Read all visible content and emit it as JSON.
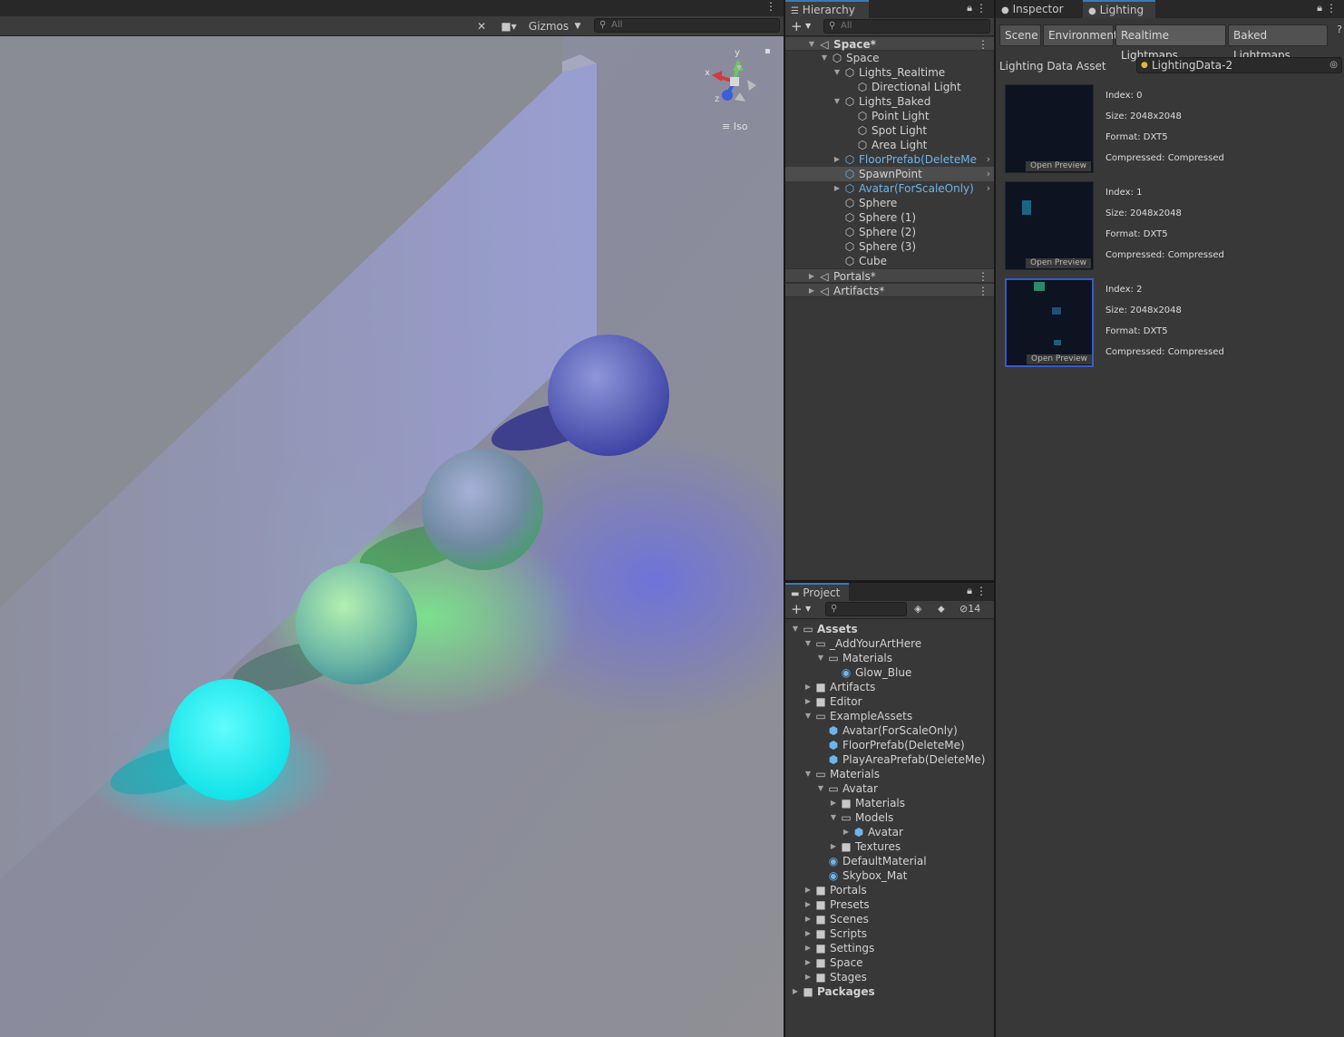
{
  "scene": {
    "toolbar": {
      "tools_icon": "crossed-tools-icon",
      "camera_icon": "camera-icon",
      "gizmos_label": "Gizmos",
      "search_placeholder": "All"
    },
    "gizmo": {
      "x_label": "x",
      "y_label": "y",
      "z_label": "z",
      "projection_label": "Iso"
    }
  },
  "hierarchy": {
    "tab_label": "Hierarchy",
    "search_placeholder": "All",
    "items": [
      {
        "label": "Space*",
        "kind": "scene",
        "depth": 0,
        "expanded": true
      },
      {
        "label": "Space",
        "kind": "object",
        "depth": 1,
        "expanded": true
      },
      {
        "label": "Lights_Realtime",
        "kind": "object",
        "depth": 2,
        "expanded": true
      },
      {
        "label": "Directional Light",
        "kind": "object",
        "depth": 3
      },
      {
        "label": "Lights_Baked",
        "kind": "object",
        "depth": 2,
        "expanded": true
      },
      {
        "label": "Point Light",
        "kind": "object",
        "depth": 3
      },
      {
        "label": "Spot Light",
        "kind": "object",
        "depth": 3
      },
      {
        "label": "Area Light",
        "kind": "object",
        "depth": 3
      },
      {
        "label": "FloorPrefab(DeleteMe",
        "kind": "prefab",
        "depth": 2,
        "expanded": false
      },
      {
        "label": "SpawnPoint",
        "kind": "prefab-plain",
        "depth": 2
      },
      {
        "label": "Avatar(ForScaleOnly)",
        "kind": "prefab",
        "depth": 2,
        "expanded": false
      },
      {
        "label": "Sphere",
        "kind": "object",
        "depth": 2
      },
      {
        "label": "Sphere (1)",
        "kind": "object",
        "depth": 2
      },
      {
        "label": "Sphere (2)",
        "kind": "object",
        "depth": 2
      },
      {
        "label": "Sphere (3)",
        "kind": "object",
        "depth": 2
      },
      {
        "label": "Cube",
        "kind": "object",
        "depth": 2
      },
      {
        "label": "Portals*",
        "kind": "scene",
        "depth": 0,
        "expanded": false
      },
      {
        "label": "Artifacts*",
        "kind": "scene",
        "depth": 0,
        "expanded": false
      }
    ]
  },
  "project": {
    "tab_label": "Project",
    "hidden_count": "14",
    "items": [
      {
        "label": "Assets",
        "kind": "folder",
        "depth": 0,
        "expanded": true,
        "bold": true
      },
      {
        "label": "_AddYourArtHere",
        "kind": "folder",
        "depth": 1,
        "expanded": true
      },
      {
        "label": "Materials",
        "kind": "folder",
        "depth": 2,
        "expanded": true
      },
      {
        "label": "Glow_Blue",
        "kind": "material",
        "depth": 3
      },
      {
        "label": "Artifacts",
        "kind": "folder",
        "depth": 1,
        "expanded": false
      },
      {
        "label": "Editor",
        "kind": "folder",
        "depth": 1,
        "expanded": false
      },
      {
        "label": "ExampleAssets",
        "kind": "folder",
        "depth": 1,
        "expanded": true
      },
      {
        "label": "Avatar(ForScaleOnly)",
        "kind": "prefab",
        "depth": 2
      },
      {
        "label": "FloorPrefab(DeleteMe)",
        "kind": "prefab",
        "depth": 2
      },
      {
        "label": "PlayAreaPrefab(DeleteMe)",
        "kind": "prefab",
        "depth": 2
      },
      {
        "label": "Materials",
        "kind": "folder",
        "depth": 1,
        "expanded": true
      },
      {
        "label": "Avatar",
        "kind": "folder",
        "depth": 2,
        "expanded": true
      },
      {
        "label": "Materials",
        "kind": "folder",
        "depth": 3,
        "expanded": false
      },
      {
        "label": "Models",
        "kind": "folder",
        "depth": 3,
        "expanded": true
      },
      {
        "label": "Avatar",
        "kind": "prefab",
        "depth": 4,
        "expanded": false
      },
      {
        "label": "Textures",
        "kind": "folder",
        "depth": 3,
        "expanded": false
      },
      {
        "label": "DefaultMaterial",
        "kind": "material",
        "depth": 2
      },
      {
        "label": "Skybox_Mat",
        "kind": "material",
        "depth": 2
      },
      {
        "label": "Portals",
        "kind": "folder",
        "depth": 1,
        "expanded": false
      },
      {
        "label": "Presets",
        "kind": "folder",
        "depth": 1,
        "expanded": false
      },
      {
        "label": "Scenes",
        "kind": "folder",
        "depth": 1,
        "expanded": false
      },
      {
        "label": "Scripts",
        "kind": "folder",
        "depth": 1,
        "expanded": false
      },
      {
        "label": "Settings",
        "kind": "folder",
        "depth": 1,
        "expanded": false
      },
      {
        "label": "Space",
        "kind": "folder",
        "depth": 1,
        "expanded": false
      },
      {
        "label": "Stages",
        "kind": "folder",
        "depth": 1,
        "expanded": false
      },
      {
        "label": "Packages",
        "kind": "folder",
        "depth": 0,
        "expanded": false,
        "bold": true
      }
    ]
  },
  "lighting": {
    "inspector_tab": "Inspector",
    "lighting_tab": "Lighting",
    "subtabs": [
      "Scene",
      "Environment",
      "Realtime Lightmaps",
      "Baked Lightmaps"
    ],
    "active_subtab": "Realtime Lightmaps",
    "data_asset_label": "Lighting Data Asset",
    "data_asset_value": "LightingData-2",
    "open_preview_label": "Open Preview",
    "lightmaps": [
      {
        "index": "Index: 0",
        "size": "Size: 2048x2048",
        "format": "Format: DXT5",
        "compressed": "Compressed: Compressed"
      },
      {
        "index": "Index: 1",
        "size": "Size: 2048x2048",
        "format": "Format: DXT5",
        "compressed": "Compressed: Compressed"
      },
      {
        "index": "Index: 2",
        "size": "Size: 2048x2048",
        "format": "Format: DXT5",
        "compressed": "Compressed: Compressed"
      }
    ]
  }
}
